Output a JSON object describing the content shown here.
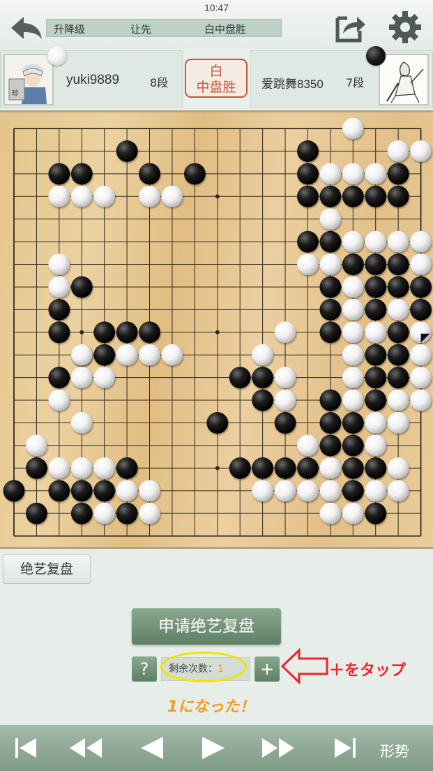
{
  "status_bar": {
    "time": "10:47"
  },
  "header": {
    "tags": [
      "升降级",
      "让先",
      "白中盘胜"
    ]
  },
  "players": {
    "white": {
      "name": "yuki9889",
      "rank": "8段",
      "stone": "white"
    },
    "black": {
      "name": "爱跳舞8350",
      "rank": "7段",
      "stone": "black"
    }
  },
  "result_seal": {
    "line1": "白",
    "line2": "中盘胜"
  },
  "board": {
    "size": 19,
    "black": [
      [
        5,
        1
      ],
      [
        2,
        2
      ],
      [
        3,
        2
      ],
      [
        6,
        2
      ],
      [
        8,
        2
      ],
      [
        3,
        7
      ],
      [
        2,
        8
      ],
      [
        2,
        9
      ],
      [
        4,
        9
      ],
      [
        5,
        9
      ],
      [
        6,
        9
      ],
      [
        3,
        10
      ],
      [
        4,
        10
      ],
      [
        2,
        11
      ],
      [
        9,
        13
      ],
      [
        1,
        15
      ],
      [
        5,
        15
      ],
      [
        0,
        16
      ],
      [
        2,
        16
      ],
      [
        3,
        16
      ],
      [
        4,
        16
      ],
      [
        1,
        17
      ],
      [
        3,
        17
      ],
      [
        5,
        17
      ],
      [
        13,
        1
      ],
      [
        13,
        2
      ],
      [
        17,
        2
      ],
      [
        13,
        3
      ],
      [
        14,
        3
      ],
      [
        15,
        3
      ],
      [
        16,
        3
      ],
      [
        17,
        3
      ],
      [
        13,
        5
      ],
      [
        14,
        5
      ],
      [
        15,
        6
      ],
      [
        16,
        6
      ],
      [
        17,
        6
      ],
      [
        14,
        7
      ],
      [
        16,
        7
      ],
      [
        17,
        7
      ],
      [
        18,
        7
      ],
      [
        14,
        8
      ],
      [
        16,
        8
      ],
      [
        18,
        8
      ],
      [
        14,
        9
      ],
      [
        17,
        9
      ],
      [
        16,
        10
      ],
      [
        17,
        10
      ],
      [
        10,
        11
      ],
      [
        11,
        11
      ],
      [
        16,
        11
      ],
      [
        17,
        11
      ],
      [
        11,
        12
      ],
      [
        14,
        12
      ],
      [
        16,
        12
      ],
      [
        12,
        13
      ],
      [
        14,
        13
      ],
      [
        15,
        13
      ],
      [
        14,
        14
      ],
      [
        15,
        14
      ],
      [
        10,
        15
      ],
      [
        11,
        15
      ],
      [
        12,
        15
      ],
      [
        13,
        15
      ],
      [
        15,
        15
      ],
      [
        16,
        15
      ],
      [
        15,
        16
      ],
      [
        16,
        17
      ]
    ],
    "white": [
      [
        15,
        0
      ],
      [
        17,
        1
      ],
      [
        18,
        1
      ],
      [
        14,
        2
      ],
      [
        15,
        2
      ],
      [
        16,
        2
      ],
      [
        2,
        3
      ],
      [
        3,
        3
      ],
      [
        4,
        3
      ],
      [
        6,
        3
      ],
      [
        7,
        3
      ],
      [
        14,
        4
      ],
      [
        15,
        5
      ],
      [
        16,
        5
      ],
      [
        17,
        5
      ],
      [
        18,
        5
      ],
      [
        2,
        6
      ],
      [
        13,
        6
      ],
      [
        14,
        6
      ],
      [
        18,
        6
      ],
      [
        2,
        7
      ],
      [
        15,
        7
      ],
      [
        15,
        8
      ],
      [
        17,
        8
      ],
      [
        12,
        9
      ],
      [
        15,
        9
      ],
      [
        16,
        9
      ],
      [
        18,
        9
      ],
      [
        3,
        10
      ],
      [
        5,
        10
      ],
      [
        6,
        10
      ],
      [
        7,
        10
      ],
      [
        11,
        10
      ],
      [
        15,
        10
      ],
      [
        18,
        10
      ],
      [
        3,
        11
      ],
      [
        4,
        11
      ],
      [
        12,
        11
      ],
      [
        15,
        11
      ],
      [
        18,
        11
      ],
      [
        2,
        12
      ],
      [
        12,
        12
      ],
      [
        15,
        12
      ],
      [
        17,
        12
      ],
      [
        18,
        12
      ],
      [
        16,
        13
      ],
      [
        17,
        13
      ],
      [
        3,
        13
      ],
      [
        1,
        14
      ],
      [
        13,
        14
      ],
      [
        16,
        14
      ],
      [
        2,
        15
      ],
      [
        3,
        15
      ],
      [
        4,
        15
      ],
      [
        14,
        15
      ],
      [
        17,
        15
      ],
      [
        5,
        16
      ],
      [
        6,
        16
      ],
      [
        11,
        16
      ],
      [
        12,
        16
      ],
      [
        13,
        16
      ],
      [
        14,
        16
      ],
      [
        16,
        16
      ],
      [
        17,
        16
      ],
      [
        4,
        17
      ],
      [
        6,
        17
      ],
      [
        14,
        17
      ],
      [
        15,
        17
      ]
    ],
    "last_move_marker": [
      18,
      9
    ]
  },
  "replay_tab": {
    "label": "绝艺复盘"
  },
  "apply_button": {
    "label": "申请绝艺复盘"
  },
  "help_button": {
    "label": "?"
  },
  "remaining": {
    "label": "剩余次数：",
    "count": "1"
  },
  "plus_button": {
    "label": "+"
  },
  "annotations": {
    "tap_note": "＋をタップ",
    "result_note": "1になった！"
  },
  "bottom_nav": {
    "items": [
      "first-icon",
      "prev10-icon",
      "prev-icon",
      "next-icon",
      "next10-icon",
      "last-icon"
    ],
    "situation_label": "形势"
  },
  "colors": {
    "accent_green": "#6b8c72",
    "seal_red": "#c8553d",
    "annotation_red": "#f2222a",
    "annotation_orange": "#f39b1b"
  }
}
